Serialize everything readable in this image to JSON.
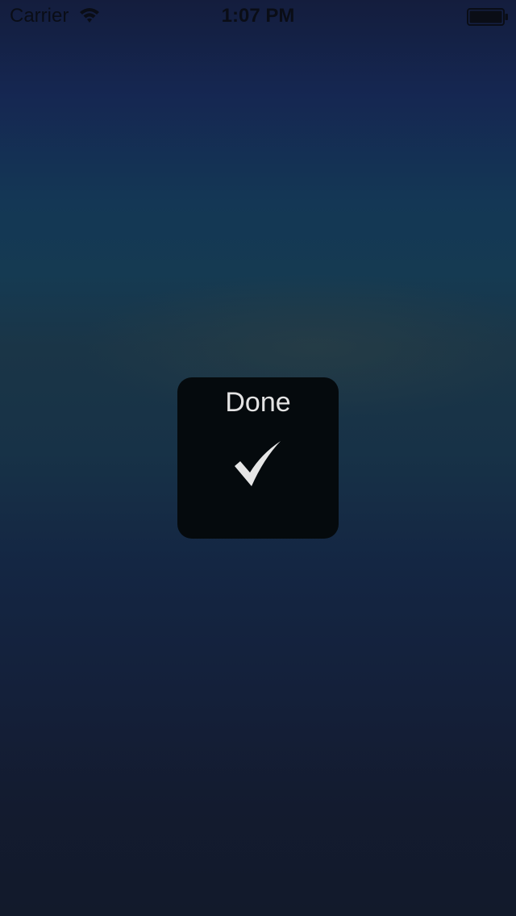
{
  "status_bar": {
    "carrier": "Carrier",
    "time": "1:07 PM",
    "wifi_icon": "wifi-icon",
    "battery_icon": "battery-icon"
  },
  "hud": {
    "label": "Done",
    "icon": "checkmark-icon"
  },
  "colors": {
    "status_text": "#0a0d16",
    "hud_background": "#050a0d",
    "hud_text": "#e4e4e4"
  }
}
